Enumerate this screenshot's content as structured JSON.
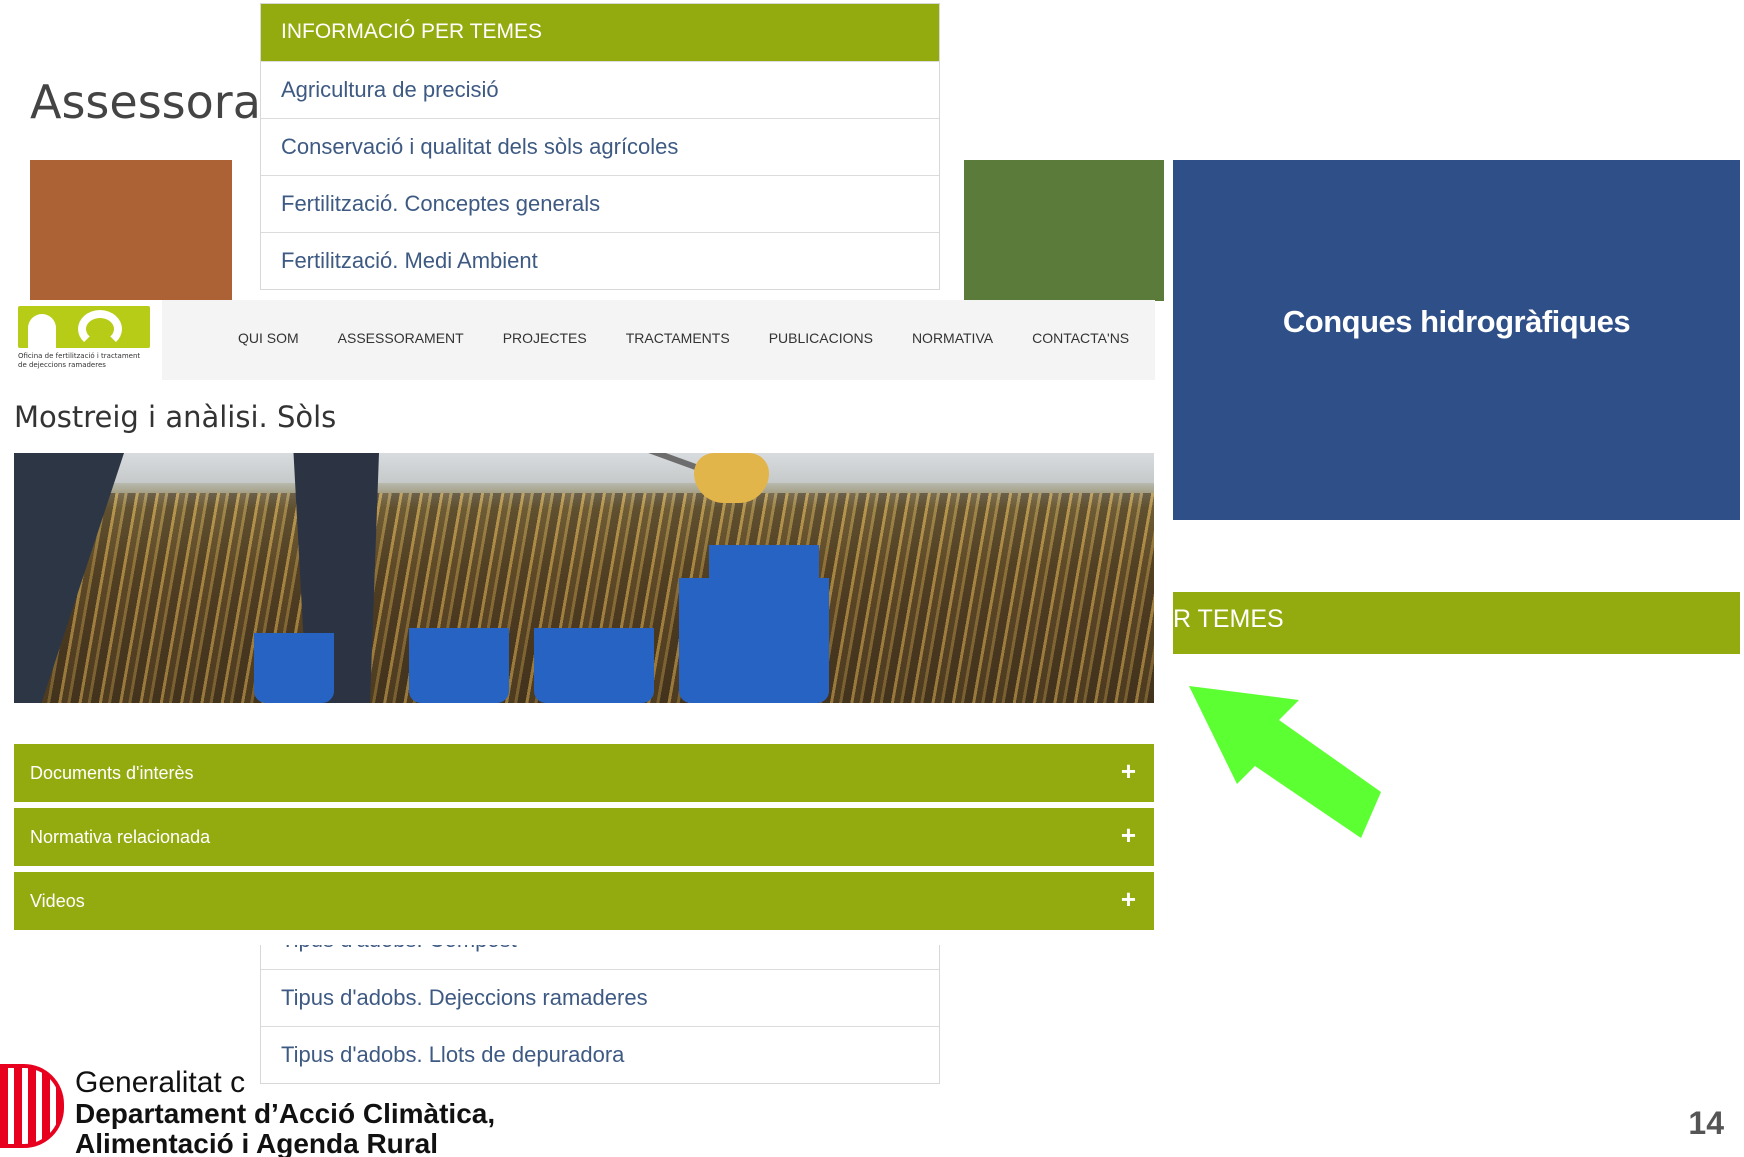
{
  "background": {
    "title": "Assessora",
    "tile_blue_label": "Conques hidrogràfiques",
    "topics_bar_right": "R TEMES",
    "colors": {
      "orange": "#ac6234",
      "green": "#5a7b39",
      "blue": "#2f4f88",
      "accent": "#94ab10"
    }
  },
  "topics": {
    "header": "INFORMACIÓ PER TEMES",
    "items": [
      "Agricultura de precisió",
      "Conservació i qualitat dels sòls agrícoles",
      "Fertilització. Conceptes generals",
      "Fertilització. Medi Ambient"
    ],
    "bottom_items": [
      "Tipus d'adobs. Compost",
      "Tipus d'adobs. Dejeccions ramaderes",
      "Tipus d'adobs. Llots de depuradora"
    ]
  },
  "site": {
    "logo_text": "Oficina de fertilització i tractament de dejeccions ramaderes",
    "nav": [
      "QUI SOM",
      "ASSESSORAMENT",
      "PROJECTES",
      "TRACTAMENTS",
      "PUBLICACIONS",
      "NORMATIVA",
      "CONTACTA'NS"
    ],
    "page_title": "Mostreig i anàlisi. Sòls",
    "accordion": [
      {
        "label": "Documents d'interès",
        "icon": "plus-icon"
      },
      {
        "label": "Normativa relacionada",
        "icon": "plus-icon"
      },
      {
        "label": "Videos",
        "icon": "plus-icon"
      }
    ]
  },
  "footer": {
    "line1": "Generalitat c",
    "line2": "Departament d’Acció Climàtica,",
    "line3": "Alimentació i Agenda Rural",
    "page_number": "14"
  },
  "annotation": {
    "arrow_color": "#5cff32",
    "icon": "arrow-icon"
  }
}
